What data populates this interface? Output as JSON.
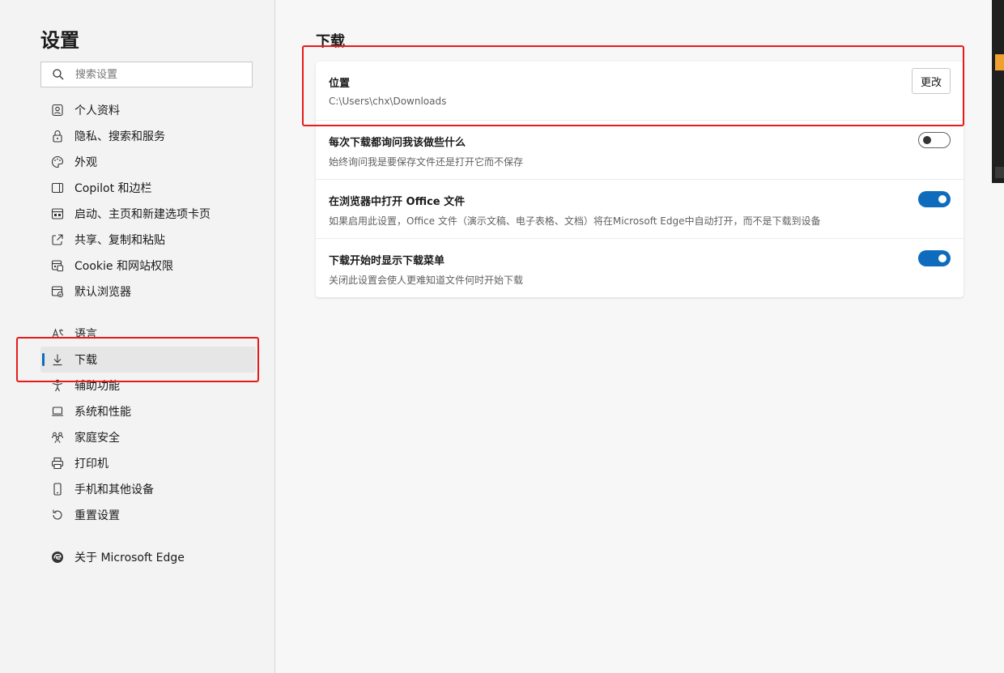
{
  "sidebar": {
    "title": "设置",
    "search_placeholder": "搜索设置",
    "items": [
      {
        "label": "个人资料",
        "icon": "profile-icon"
      },
      {
        "label": "隐私、搜索和服务",
        "icon": "lock-icon"
      },
      {
        "label": "外观",
        "icon": "palette-icon"
      },
      {
        "label": "Copilot 和边栏",
        "icon": "sidebar-icon"
      },
      {
        "label": "启动、主页和新建选项卡页",
        "icon": "home-icon"
      },
      {
        "label": "共享、复制和粘贴",
        "icon": "share-icon"
      },
      {
        "label": "Cookie 和网站权限",
        "icon": "site-permissions-icon"
      },
      {
        "label": "默认浏览器",
        "icon": "browser-icon"
      },
      {
        "label": "语言",
        "icon": "language-icon"
      },
      {
        "label": "下载",
        "icon": "download-icon",
        "active": true
      },
      {
        "label": "辅助功能",
        "icon": "accessibility-icon"
      },
      {
        "label": "系统和性能",
        "icon": "laptop-icon"
      },
      {
        "label": "家庭安全",
        "icon": "family-icon"
      },
      {
        "label": "打印机",
        "icon": "printer-icon"
      },
      {
        "label": "手机和其他设备",
        "icon": "phone-icon"
      },
      {
        "label": "重置设置",
        "icon": "reset-icon"
      },
      {
        "label": "关于 Microsoft Edge",
        "icon": "edge-logo-icon"
      }
    ]
  },
  "main": {
    "title": "下载",
    "location": {
      "title": "位置",
      "path": "C:\\Users\\chx\\Downloads",
      "button": "更改"
    },
    "settings": [
      {
        "title": "每次下载都询问我该做些什么",
        "description": "始终询问我是要保存文件还是打开它而不保存",
        "enabled": false
      },
      {
        "title": "在浏览器中打开 Office 文件",
        "description": "如果启用此设置，Office 文件（演示文稿、电子表格、文档）将在Microsoft Edge中自动打开，而不是下载到设备",
        "enabled": true
      },
      {
        "title": "下载开始时显示下载菜单",
        "description": "关闭此设置会使人更难知道文件何时开始下载",
        "enabled": true
      }
    ]
  },
  "colors": {
    "accent": "#0f6cbd",
    "highlight": "#e81a1a"
  }
}
